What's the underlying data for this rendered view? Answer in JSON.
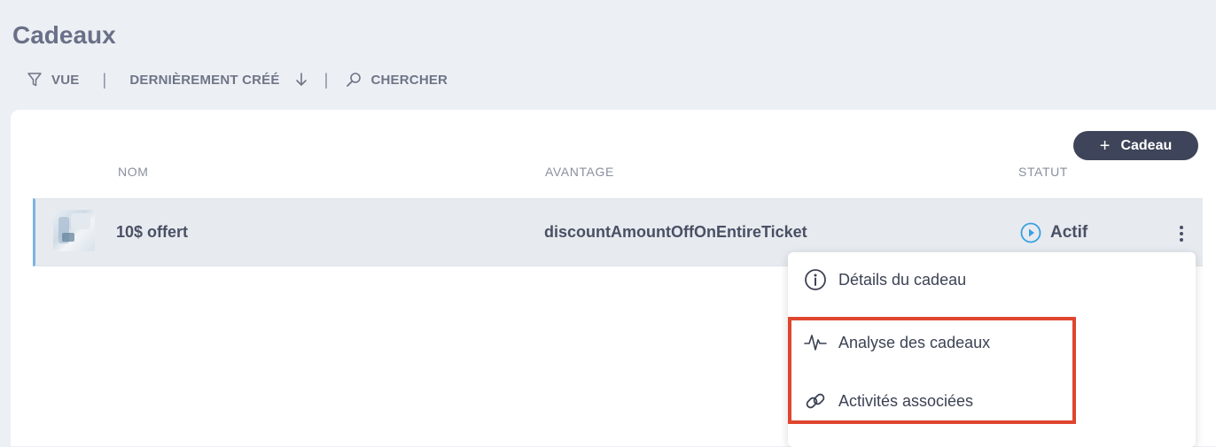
{
  "page": {
    "title": "Cadeaux"
  },
  "toolbar": {
    "view_label": "VUE",
    "sort_label": "DERNIÈREMENT CRÉÉ",
    "search_label": "CHERCHER",
    "separator": "|"
  },
  "actions": {
    "add_plus": "+",
    "add_label": "Cadeau"
  },
  "table": {
    "columns": [
      "NOM",
      "AVANTAGE",
      "STATUT"
    ],
    "rows": [
      {
        "name": "10$ offert",
        "advantage": "discountAmountOffOnEntireTicket",
        "status": "Actif"
      }
    ]
  },
  "context_menu": {
    "items": [
      {
        "label": "Détails du cadeau",
        "icon": "info-circle-icon"
      },
      {
        "label": "Analyse des cadeaux",
        "icon": "pulse-icon"
      },
      {
        "label": "Activités associées",
        "icon": "link-icon"
      }
    ]
  },
  "colors": {
    "highlight": "#e0452f",
    "status_active": "#3aa0e0",
    "row_accent": "#7fb2e0",
    "button_bg": "#3e4459"
  }
}
